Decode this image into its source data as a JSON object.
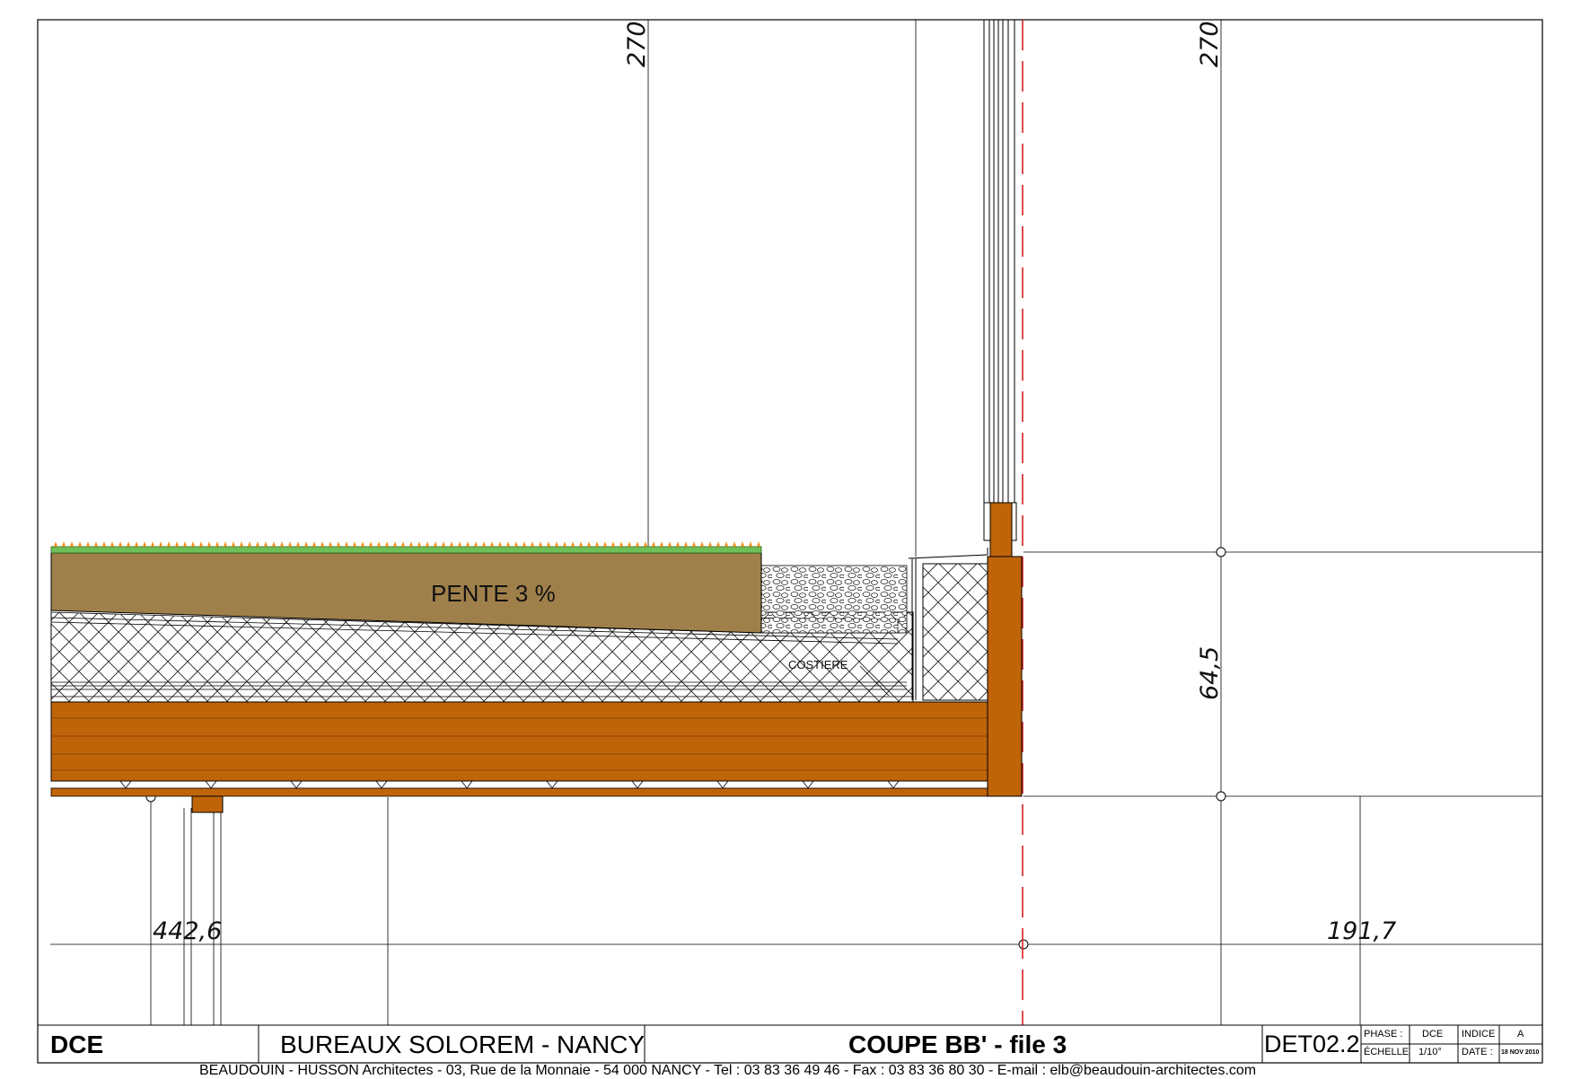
{
  "drawing": {
    "slope_label": "PENTE 3 %",
    "costiere_label": "COSTIERE",
    "dimensions": {
      "top_left": "270",
      "top_right": "270",
      "right_mid": "64,5",
      "bottom_left": "442,6",
      "bottom_right": "191,7"
    },
    "colors": {
      "timber": "#c0640a",
      "earth": "#a0804a",
      "vegetation": "#6fbf5a",
      "flowers": "#f08a1a",
      "axis": "#d62020"
    }
  },
  "title_block": {
    "phase_code": "DCE",
    "project": "BUREAUX SOLOREM - NANCY",
    "sheet_title": "COUPE BB' - file 3",
    "sheet_number": "DET02.2",
    "phase_label": "PHASE :",
    "phase_value": "DCE",
    "index_label": "INDICE",
    "index_value": "A",
    "scale_label": "ÉCHELLE",
    "scale_value": "1/10°",
    "date_label": "DATE :",
    "date_value": "18 NOV 2010"
  },
  "footer": "BEAUDOUIN - HUSSON  Architectes - 03, Rue de la Monnaie - 54 000  NANCY - Tel : 03 83 36 49 46 - Fax : 03 83 36 80 30 - E-mail : elb@beaudouin-architectes.com"
}
